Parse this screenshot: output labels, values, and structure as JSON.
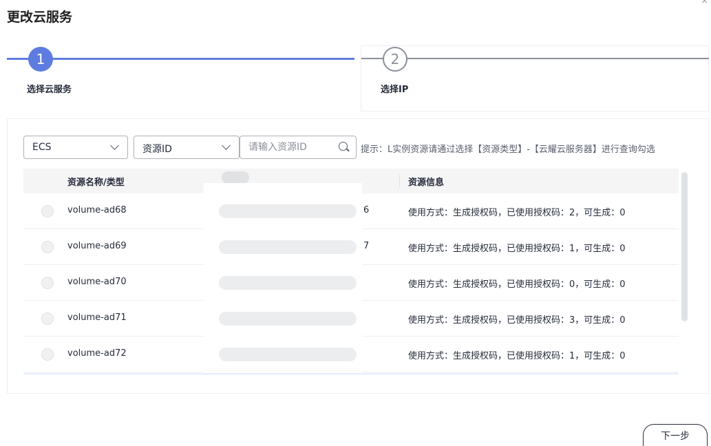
{
  "dialog": {
    "title": "更改云服务",
    "close_glyph": "×"
  },
  "steps": [
    {
      "number": "1",
      "label": "选择云服务"
    },
    {
      "number": "2",
      "label": "选择IP"
    }
  ],
  "filters": {
    "type_select": "ECS",
    "field_select": "资源ID",
    "search_placeholder": "请输入资源ID",
    "hint": "提示：L实例资源请通过选择【资源类型】-【云耀云服务器】进行查询勾选"
  },
  "table": {
    "headers": {
      "name": "资源名称/类型",
      "info": "资源信息"
    },
    "rows": [
      {
        "name": "volume-ad68",
        "tail": "6",
        "info": "使用方式：生成授权码，已使用授权码：2，可生成：0"
      },
      {
        "name": "volume-ad69",
        "tail": "7",
        "info": "使用方式：生成授权码，已使用授权码：1，可生成：0"
      },
      {
        "name": "volume-ad70",
        "tail": "",
        "info": "使用方式：生成授权码，已使用授权码：0，可生成：0"
      },
      {
        "name": "volume-ad71",
        "tail": "",
        "info": "使用方式：生成授权码，已使用授权码：3，可生成：0"
      },
      {
        "name": "volume-ad72",
        "tail": "",
        "info": "使用方式：生成授权码，已使用授权码：1，可生成：0"
      }
    ]
  },
  "footer": {
    "next_label": "下一步"
  },
  "colors": {
    "accent": "#5e7ce0",
    "inactive": "#8a8e99"
  }
}
